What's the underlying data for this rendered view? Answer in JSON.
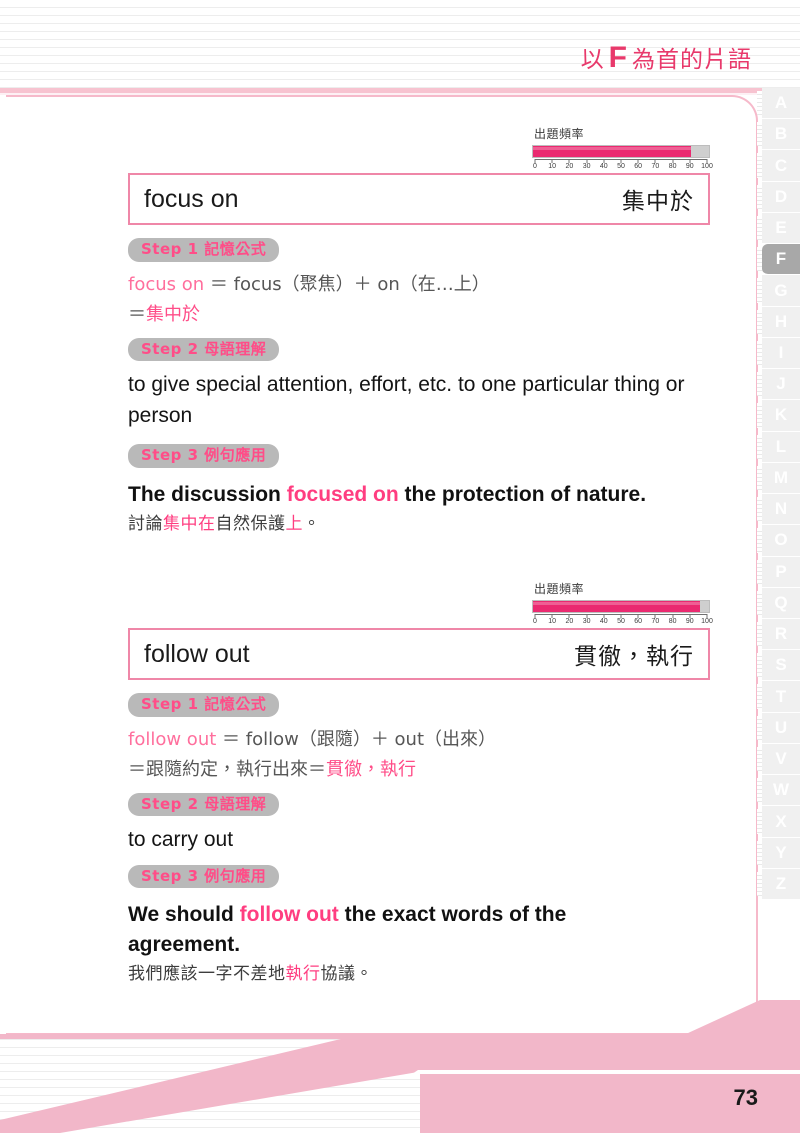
{
  "page": {
    "running_head_prefix": "以",
    "running_head_letter": "F",
    "running_head_suffix": "為首的片語",
    "page_number": "73",
    "accent_pink": "#ea2a70",
    "light_pink": "#f2b7c9",
    "badge_gray": "#b9b9b9"
  },
  "index_strip": {
    "active_letter": "F",
    "letters": [
      "A",
      "B",
      "C",
      "D",
      "E",
      "F",
      "G",
      "H",
      "I",
      "J",
      "K",
      "L",
      "M",
      "N",
      "O",
      "P",
      "Q",
      "R",
      "S",
      "T",
      "U",
      "V",
      "W",
      "X",
      "Y",
      "Z"
    ]
  },
  "entries": [
    {
      "frequency": {
        "label": "出題頻率",
        "value": 90,
        "max": 100,
        "ticks": [
          0,
          10,
          20,
          30,
          40,
          50,
          60,
          70,
          80,
          90,
          100
        ]
      },
      "headword_en": "focus on",
      "headword_zh": "集中於",
      "step1": {
        "badge": "Step 1  記憶公式",
        "formula_line1_a": "focus on",
        "formula_line1_b": " ＝ focus（聚焦）＋ on（在…上）",
        "formula_line2_a": "＝",
        "formula_line2_b": "集中於"
      },
      "step2": {
        "badge": "Step 2  母語理解",
        "definition": "to give special attention, effort, etc. to one particular thing or person"
      },
      "step3": {
        "badge": "Step 3  例句應用",
        "example_en_pre": "The discussion ",
        "example_en_hl": "focused on",
        "example_en_post": " the protection of nature.",
        "example_zh_1": "討論",
        "example_zh_hl1": "集中在",
        "example_zh_2": "自然保護",
        "example_zh_hl2": "上",
        "example_zh_3": "。"
      }
    },
    {
      "frequency": {
        "label": "出題頻率",
        "value": 95,
        "max": 100,
        "ticks": [
          0,
          10,
          20,
          30,
          40,
          50,
          60,
          70,
          80,
          90,
          100
        ]
      },
      "headword_en": "follow out",
      "headword_zh": "貫徹，執行",
      "step1": {
        "badge": "Step 1  記憶公式",
        "formula_line1_a": "follow out",
        "formula_line1_b": " ＝ follow（跟隨）＋ out（出來）",
        "formula_line2_a": "＝跟隨約定，執行出來＝",
        "formula_line2_b": "貫徹，執行"
      },
      "step2": {
        "badge": "Step 2  母語理解",
        "definition": "to carry out"
      },
      "step3": {
        "badge": "Step 3  例句應用",
        "example_en_pre": "We should ",
        "example_en_hl": "follow out",
        "example_en_post": " the exact words of the agreement.",
        "example_zh_1": "我們應該一字不差地",
        "example_zh_hl1": "執行",
        "example_zh_2": "協議",
        "example_zh_hl2": "",
        "example_zh_3": "。"
      }
    }
  ]
}
